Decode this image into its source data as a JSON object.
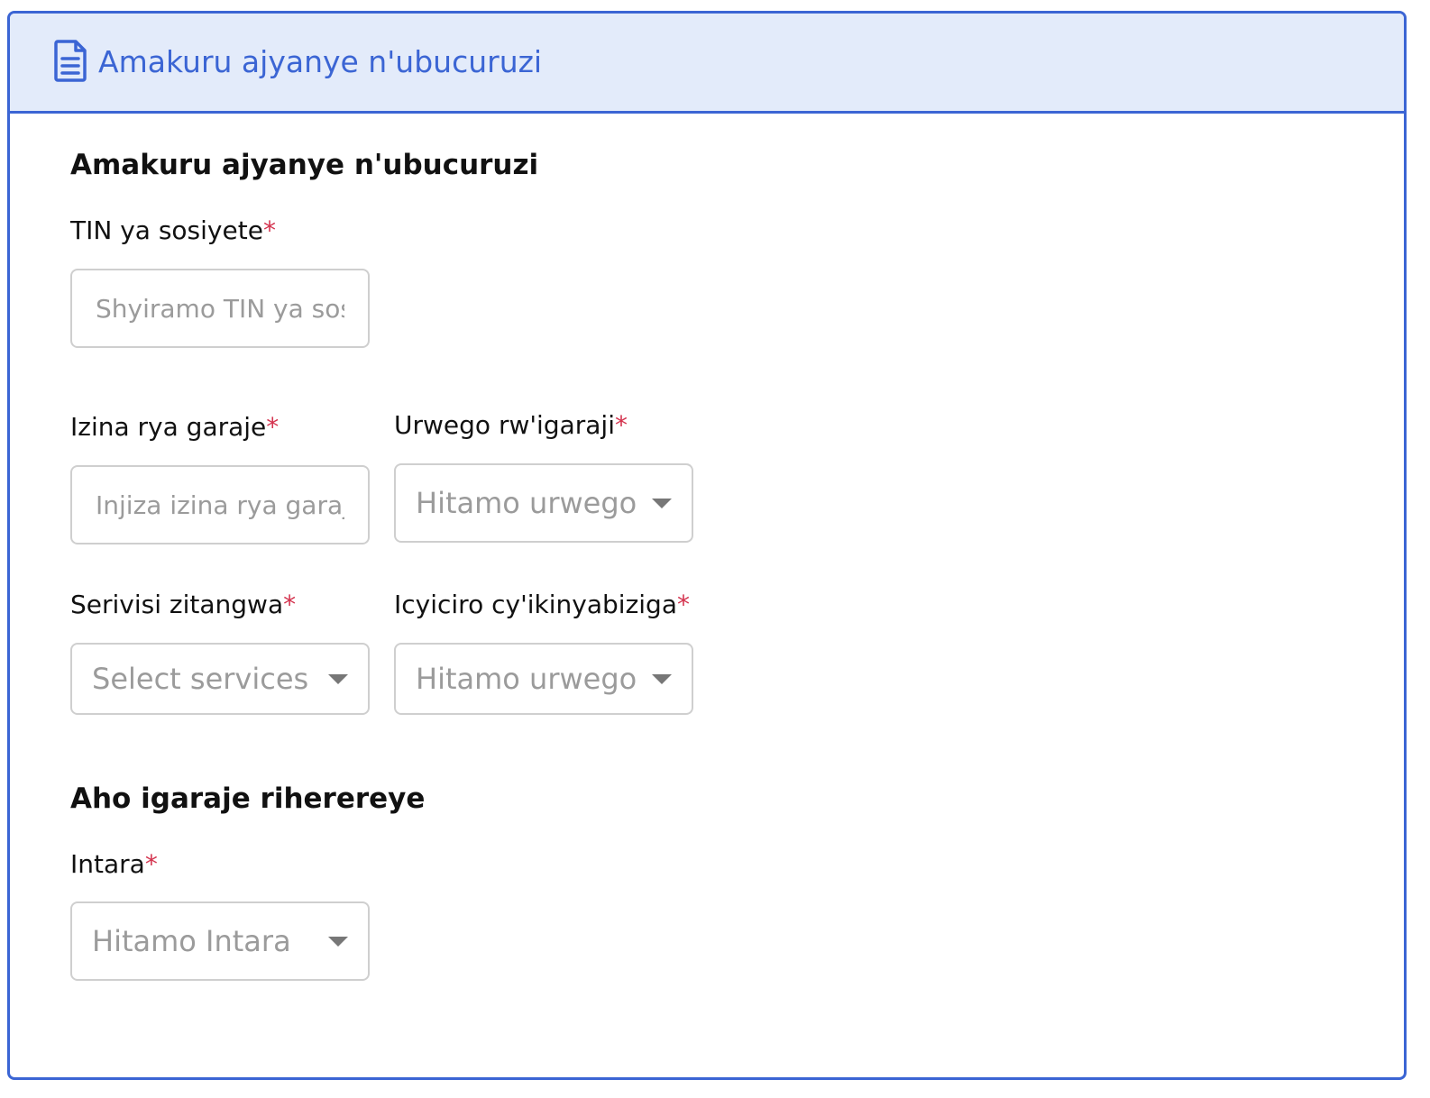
{
  "header": {
    "title": "Amakuru ajyanye n'ubucuruzi",
    "icon": "document-icon",
    "accent_color": "#3b65d4",
    "background_color": "#e3ebfa"
  },
  "sections": {
    "business": {
      "title": "Amakuru ajyanye n'ubucuruzi"
    },
    "location": {
      "title": "Aho igaraje riherereye"
    }
  },
  "fields": {
    "tin": {
      "label": "TIN ya sosiyete",
      "required_mark": "*",
      "placeholder": "Shyiramo TIN ya sosiyete",
      "value": ""
    },
    "garage_name": {
      "label": "Izina rya garaje",
      "required_mark": "*",
      "placeholder": "Injiza izina rya garaje",
      "value": ""
    },
    "garage_level": {
      "label": "Urwego rw'igaraji",
      "required_mark": "*",
      "selected": "Hitamo urwego"
    },
    "services": {
      "label": "Serivisi zitangwa",
      "required_mark": "*",
      "selected": "Select services"
    },
    "vehicle_category": {
      "label": "Icyiciro cy'ikinyabiziga",
      "required_mark": "*",
      "selected": "Hitamo urwego"
    },
    "province": {
      "label": "Intara",
      "required_mark": "*",
      "selected": "Hitamo Intara"
    }
  },
  "colors": {
    "required": "#d4344f",
    "border": "#cfcfcf",
    "placeholder": "#9b9b9b"
  }
}
